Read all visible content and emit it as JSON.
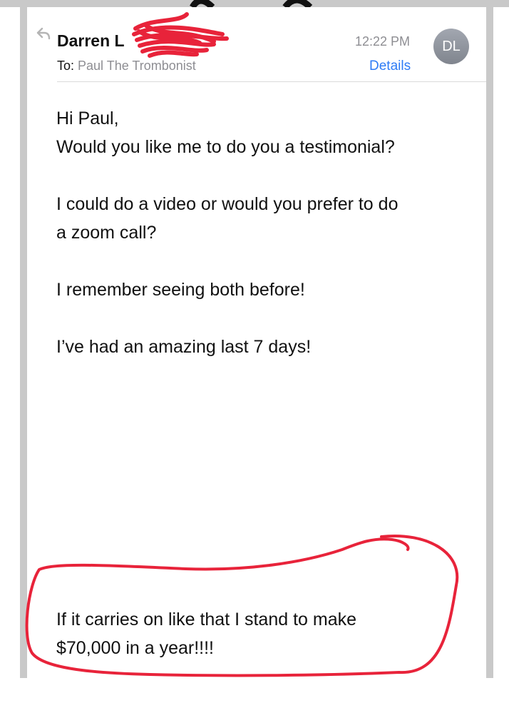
{
  "email": {
    "sender_name": "Darren L",
    "to_label": "To:",
    "to_value": "Paul The Trombonist",
    "time": "12:22 PM",
    "details_link": "Details",
    "avatar_initials": "DL",
    "body": {
      "line1": "Hi Paul,",
      "line2": "Would you like me to do you a testimonial?",
      "line3": "I could do a video or would you prefer to do",
      "line4": "a zoom call?",
      "line5": "I remember seeing both before!",
      "line6": "I’ve had an amazing last 7 days!",
      "line7": "If it carries on like that I stand to make",
      "line8": "$70,000 in a year!!!!"
    }
  },
  "colors": {
    "link": "#2e7cf6",
    "secondary_text": "#8e8e93",
    "annotation_red": "#e8233a",
    "avatar": "#8f949c"
  },
  "icons": {
    "reply": "reply-arrow-icon"
  }
}
